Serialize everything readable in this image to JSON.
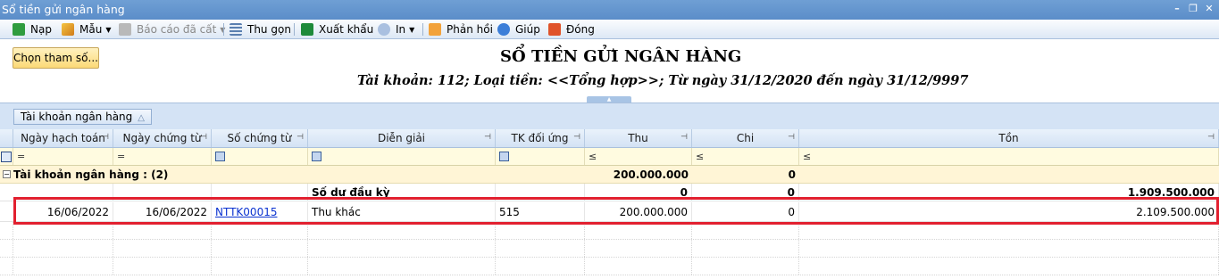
{
  "window": {
    "title": "Sổ tiền gửi ngân hàng"
  },
  "toolbar": {
    "reload": "Nạp",
    "template": "Mẫu",
    "saved_reports": "Báo cáo đã cất",
    "collapse": "Thu gọn",
    "export": "Xuất khẩu",
    "print": "In",
    "feedback": "Phản hồi",
    "help": "Giúp",
    "close": "Đóng"
  },
  "params_button": "Chọn tham số...",
  "report": {
    "title": "SỔ TIỀN GỬI NGÂN HÀNG",
    "subtitle": "Tài khoản: 112; Loại tiền: <<Tổng hợp>>; Từ ngày 31/12/2020 đến ngày 31/12/9997"
  },
  "group_chip": "Tài khoản ngân hàng",
  "columns": [
    "Ngày hạch toán",
    "Ngày chứng từ",
    "Số chứng từ",
    "Diễn giải",
    "TK đối ứng",
    "Thu",
    "Chi",
    "Tồn"
  ],
  "filter_ops": {
    "eq1": "=",
    "eq2": "=",
    "le1": "≤",
    "le2": "≤",
    "le3": "≤"
  },
  "group_row": {
    "label": "Tài khoản ngân hàng : (2)",
    "thu": "200.000.000",
    "chi": "0"
  },
  "opening_row": {
    "label": "Số dư đầu kỳ",
    "thu": "0",
    "chi": "0",
    "ton": "1.909.500.000"
  },
  "data_rows": [
    {
      "ngay_hach_toan": "16/06/2022",
      "ngay_chung_tu": "16/06/2022",
      "so_chung_tu": "NTTK00015",
      "dien_giai": "Thu khác",
      "tk_doi_ung": "515",
      "thu": "200.000.000",
      "chi": "0",
      "ton": "2.109.500.000"
    }
  ],
  "colors": {
    "titlebar": "#5b8dc9",
    "highlight": "#e2202f",
    "link": "#0a32d0"
  },
  "icons": [
    "reload-icon",
    "template-icon",
    "save-icon",
    "collapse-icon",
    "excel-icon",
    "print-icon",
    "feedback-icon",
    "help-icon",
    "close-icon"
  ]
}
